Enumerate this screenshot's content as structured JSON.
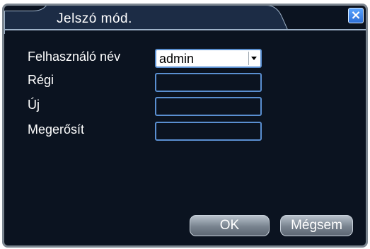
{
  "dialog": {
    "title": "Jelszó mód.",
    "close_label": "×"
  },
  "form": {
    "username_label": "Felhasználó név",
    "username_value": "admin",
    "old_label": "Régi",
    "new_label": "Új",
    "confirm_label": "Megerősít"
  },
  "buttons": {
    "ok": "OK",
    "cancel": "Mégsem"
  },
  "colors": {
    "background": "#0b1320",
    "field_border": "#5a8fd1",
    "title_tab": "#2a3c5a"
  }
}
